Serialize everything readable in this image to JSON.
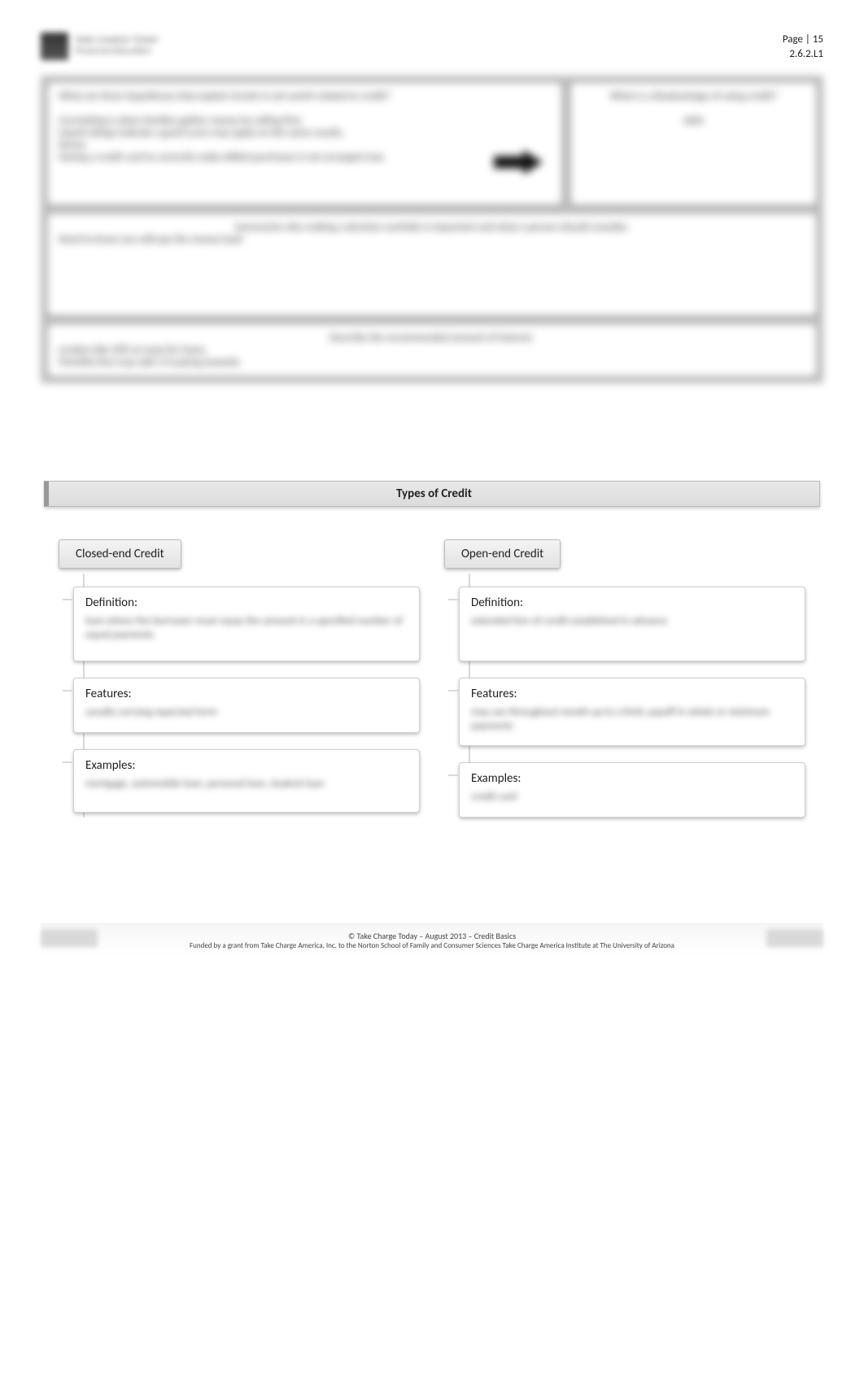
{
  "header": {
    "logo_title": "TAKE CHARGE TODAY",
    "logo_sub": "Financial Education",
    "page_label": "Page | 15",
    "code": "2.6.2.L1"
  },
  "top_frame": {
    "left_panel": "What are three hypotheses that explain trends in net worth related to credit?\n\nCorrelating is when families gather money by selling first.\nLiquid ratings indicate a good score may apply on the same results.\nDemo:\nHaving a credit card to correctly make skilled purchases is not arranged now.",
    "right_title": "What is a disadvantage of using credit?",
    "right_body": "debt",
    "wide1_title": "Summarize why making a decision carefully is important and what a person should consider.",
    "wide1_body": "Need to know you will pay the money back",
    "wide2_title": "Describe the recommended amount of interest.",
    "wide2_body": "Lenders like 20% at most for loans.\nMonthly fees may add 1/4 paying towards."
  },
  "types": {
    "section_title": "Types of Credit",
    "closed": {
      "label": "Closed-end Credit",
      "definition_label": "Definition:",
      "definition_body": "loan where the borrower must repay the amount in a specified number of equal payments",
      "features_label": "Features:",
      "features_body": "usually carrying expected term",
      "examples_label": "Examples:",
      "examples_body": "mortgage, automobile loan, personal loan, student loan"
    },
    "open": {
      "label": "Open-end Credit",
      "definition_label": "Definition:",
      "definition_body": "extended line of credit established in advance",
      "features_label": "Features:",
      "features_body": "may use throughout month up to a limit; payoff in whole or minimum payments",
      "examples_label": "Examples:",
      "examples_body": "credit card"
    }
  },
  "footer": {
    "line1": "© Take Charge Today – August 2013 – Credit Basics",
    "line2": "Funded by a grant from Take Charge America, Inc. to the Norton School of Family and Consumer Sciences Take Charge America Institute at The University of Arizona"
  }
}
